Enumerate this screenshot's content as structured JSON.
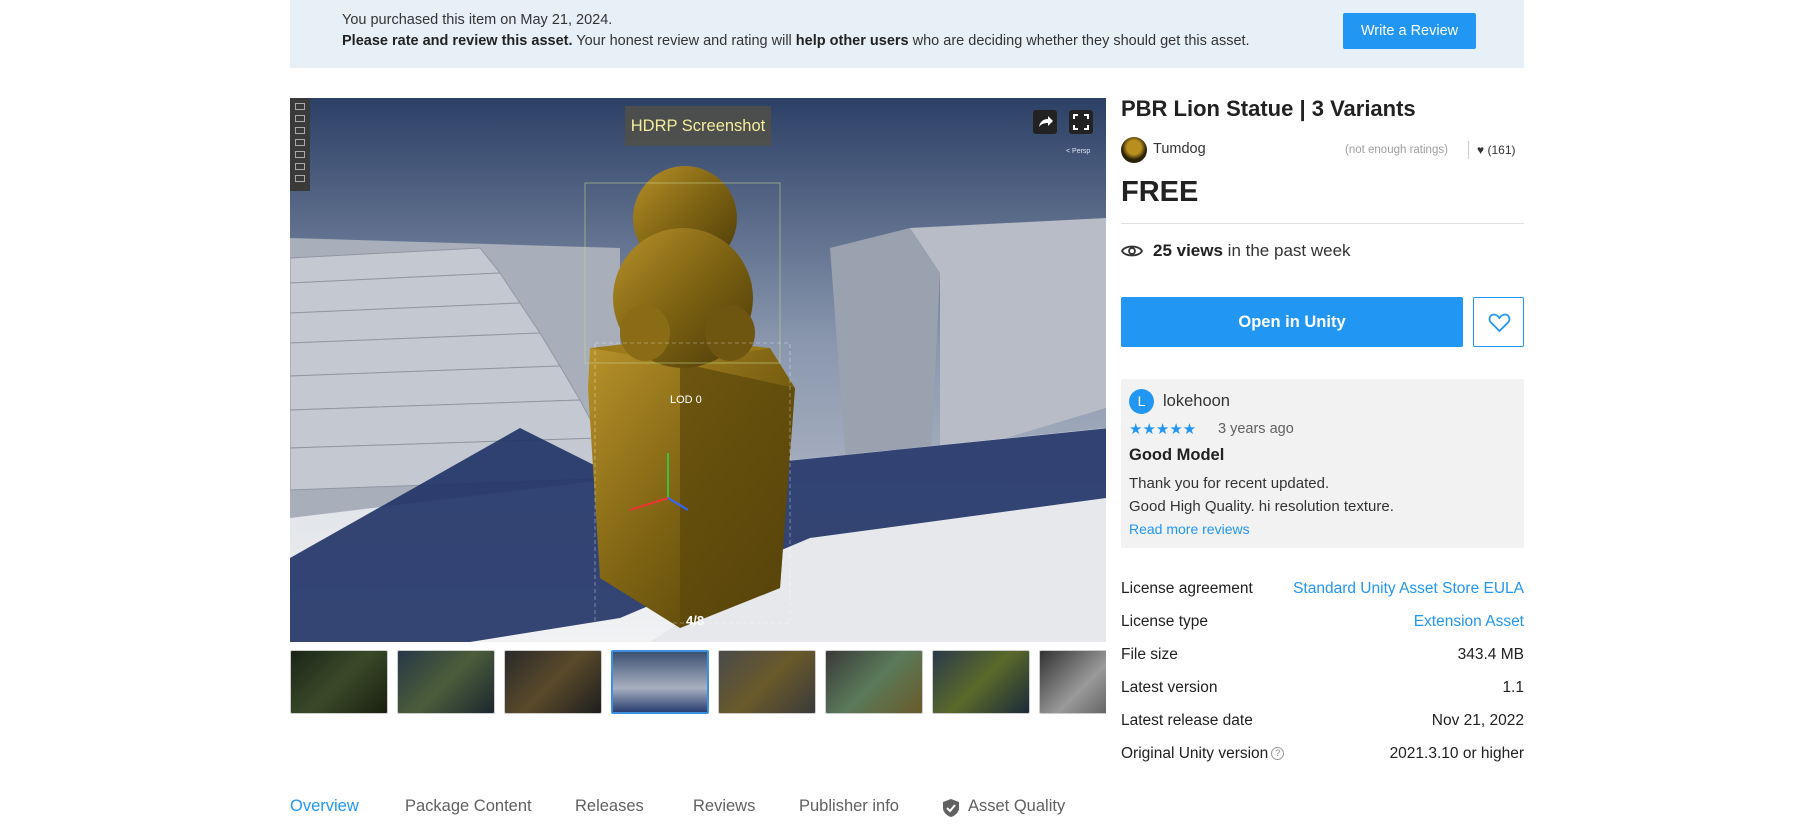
{
  "banner": {
    "line1": "You purchased this item on May 21, 2024.",
    "line2_b1": "Please rate and review this asset.",
    "line2_t1": " Your honest review and rating will ",
    "line2_b2": "help other users",
    "line2_t2": " who are deciding whether they should get this asset.",
    "write_review": "Write a Review"
  },
  "viewer": {
    "label": "HDRP Screenshot",
    "lod": "LOD 0",
    "persp": "< Persp",
    "counter": "4/8",
    "share_icon": "share-icon",
    "fullscreen_icon": "fullscreen-icon"
  },
  "thumbnails": {
    "count": 8,
    "active_index": 3
  },
  "product": {
    "title": "PBR Lion Statue | 3 Variants",
    "publisher": "Tumdog",
    "ratings_note": "(not enough ratings)",
    "favorites": "(161)",
    "price": "FREE",
    "views_count": "25 views",
    "views_suffix": " in the past week",
    "open_button": "Open in Unity",
    "accent": "#2196f3"
  },
  "review": {
    "avatar_letter": "L",
    "user": "lokehoon",
    "stars": "★★★★★",
    "rating": 5,
    "date": "3 years ago",
    "title": "Good Model",
    "body1": "Thank you for recent updated.",
    "body2": "Good High Quality. hi resolution texture.",
    "read_more": "Read more reviews"
  },
  "details": [
    {
      "key": "License agreement",
      "value": "Standard Unity Asset Store EULA",
      "link": true
    },
    {
      "key": "License type",
      "value": "Extension Asset",
      "link": true
    },
    {
      "key": "File size",
      "value": "343.4 MB",
      "link": false
    },
    {
      "key": "Latest version",
      "value": "1.1",
      "link": false
    },
    {
      "key": "Latest release date",
      "value": "Nov 21, 2022",
      "link": false
    },
    {
      "key": "Original Unity version",
      "value": "2021.3.10 or higher",
      "link": false
    }
  ],
  "tabs": [
    "Overview",
    "Package Content",
    "Releases",
    "Reviews",
    "Publisher info",
    "Asset Quality"
  ]
}
